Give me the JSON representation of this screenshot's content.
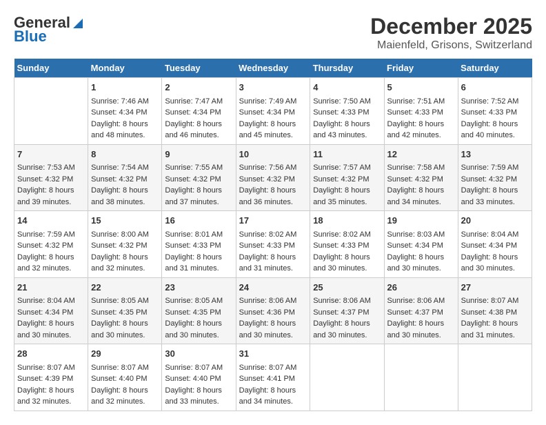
{
  "header": {
    "logo_general": "General",
    "logo_blue": "Blue",
    "month": "December 2025",
    "location": "Maienfeld, Grisons, Switzerland"
  },
  "weekdays": [
    "Sunday",
    "Monday",
    "Tuesday",
    "Wednesday",
    "Thursday",
    "Friday",
    "Saturday"
  ],
  "weeks": [
    [
      {
        "day": "",
        "info": ""
      },
      {
        "day": "1",
        "info": "Sunrise: 7:46 AM\nSunset: 4:34 PM\nDaylight: 8 hours\nand 48 minutes."
      },
      {
        "day": "2",
        "info": "Sunrise: 7:47 AM\nSunset: 4:34 PM\nDaylight: 8 hours\nand 46 minutes."
      },
      {
        "day": "3",
        "info": "Sunrise: 7:49 AM\nSunset: 4:34 PM\nDaylight: 8 hours\nand 45 minutes."
      },
      {
        "day": "4",
        "info": "Sunrise: 7:50 AM\nSunset: 4:33 PM\nDaylight: 8 hours\nand 43 minutes."
      },
      {
        "day": "5",
        "info": "Sunrise: 7:51 AM\nSunset: 4:33 PM\nDaylight: 8 hours\nand 42 minutes."
      },
      {
        "day": "6",
        "info": "Sunrise: 7:52 AM\nSunset: 4:33 PM\nDaylight: 8 hours\nand 40 minutes."
      }
    ],
    [
      {
        "day": "7",
        "info": "Sunrise: 7:53 AM\nSunset: 4:32 PM\nDaylight: 8 hours\nand 39 minutes."
      },
      {
        "day": "8",
        "info": "Sunrise: 7:54 AM\nSunset: 4:32 PM\nDaylight: 8 hours\nand 38 minutes."
      },
      {
        "day": "9",
        "info": "Sunrise: 7:55 AM\nSunset: 4:32 PM\nDaylight: 8 hours\nand 37 minutes."
      },
      {
        "day": "10",
        "info": "Sunrise: 7:56 AM\nSunset: 4:32 PM\nDaylight: 8 hours\nand 36 minutes."
      },
      {
        "day": "11",
        "info": "Sunrise: 7:57 AM\nSunset: 4:32 PM\nDaylight: 8 hours\nand 35 minutes."
      },
      {
        "day": "12",
        "info": "Sunrise: 7:58 AM\nSunset: 4:32 PM\nDaylight: 8 hours\nand 34 minutes."
      },
      {
        "day": "13",
        "info": "Sunrise: 7:59 AM\nSunset: 4:32 PM\nDaylight: 8 hours\nand 33 minutes."
      }
    ],
    [
      {
        "day": "14",
        "info": "Sunrise: 7:59 AM\nSunset: 4:32 PM\nDaylight: 8 hours\nand 32 minutes."
      },
      {
        "day": "15",
        "info": "Sunrise: 8:00 AM\nSunset: 4:32 PM\nDaylight: 8 hours\nand 32 minutes."
      },
      {
        "day": "16",
        "info": "Sunrise: 8:01 AM\nSunset: 4:33 PM\nDaylight: 8 hours\nand 31 minutes."
      },
      {
        "day": "17",
        "info": "Sunrise: 8:02 AM\nSunset: 4:33 PM\nDaylight: 8 hours\nand 31 minutes."
      },
      {
        "day": "18",
        "info": "Sunrise: 8:02 AM\nSunset: 4:33 PM\nDaylight: 8 hours\nand 30 minutes."
      },
      {
        "day": "19",
        "info": "Sunrise: 8:03 AM\nSunset: 4:34 PM\nDaylight: 8 hours\nand 30 minutes."
      },
      {
        "day": "20",
        "info": "Sunrise: 8:04 AM\nSunset: 4:34 PM\nDaylight: 8 hours\nand 30 minutes."
      }
    ],
    [
      {
        "day": "21",
        "info": "Sunrise: 8:04 AM\nSunset: 4:34 PM\nDaylight: 8 hours\nand 30 minutes."
      },
      {
        "day": "22",
        "info": "Sunrise: 8:05 AM\nSunset: 4:35 PM\nDaylight: 8 hours\nand 30 minutes."
      },
      {
        "day": "23",
        "info": "Sunrise: 8:05 AM\nSunset: 4:35 PM\nDaylight: 8 hours\nand 30 minutes."
      },
      {
        "day": "24",
        "info": "Sunrise: 8:06 AM\nSunset: 4:36 PM\nDaylight: 8 hours\nand 30 minutes."
      },
      {
        "day": "25",
        "info": "Sunrise: 8:06 AM\nSunset: 4:37 PM\nDaylight: 8 hours\nand 30 minutes."
      },
      {
        "day": "26",
        "info": "Sunrise: 8:06 AM\nSunset: 4:37 PM\nDaylight: 8 hours\nand 30 minutes."
      },
      {
        "day": "27",
        "info": "Sunrise: 8:07 AM\nSunset: 4:38 PM\nDaylight: 8 hours\nand 31 minutes."
      }
    ],
    [
      {
        "day": "28",
        "info": "Sunrise: 8:07 AM\nSunset: 4:39 PM\nDaylight: 8 hours\nand 32 minutes."
      },
      {
        "day": "29",
        "info": "Sunrise: 8:07 AM\nSunset: 4:40 PM\nDaylight: 8 hours\nand 32 minutes."
      },
      {
        "day": "30",
        "info": "Sunrise: 8:07 AM\nSunset: 4:40 PM\nDaylight: 8 hours\nand 33 minutes."
      },
      {
        "day": "31",
        "info": "Sunrise: 8:07 AM\nSunset: 4:41 PM\nDaylight: 8 hours\nand 34 minutes."
      },
      {
        "day": "",
        "info": ""
      },
      {
        "day": "",
        "info": ""
      },
      {
        "day": "",
        "info": ""
      }
    ]
  ]
}
